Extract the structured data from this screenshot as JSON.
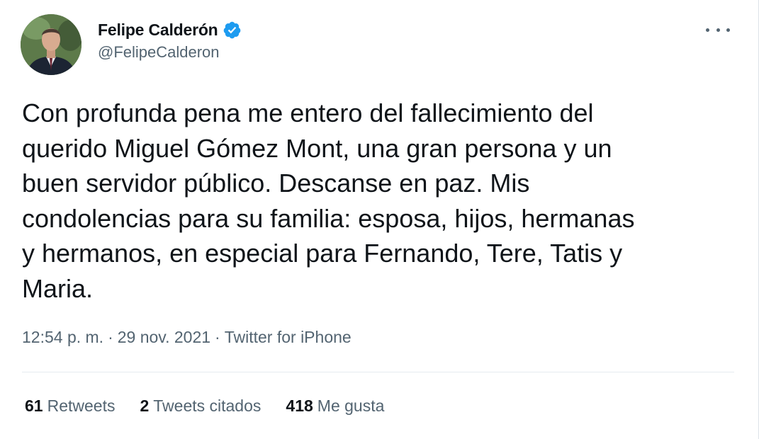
{
  "author": {
    "display_name": "Felipe Calderón",
    "handle": "@FelipeCalderon",
    "verified": true,
    "verified_icon": "verified-badge-icon"
  },
  "menu": {
    "icon": "more-options-icon"
  },
  "tweet": {
    "text": "Con profunda pena me entero del fallecimiento del\nquerido Miguel Gómez Mont, una gran persona y un\nbuen servidor público. Descanse en paz. Mis\ncondolencias para su familia: esposa, hijos, hermanas\ny hermanos, en especial para Fernando, Tere, Tatis y\nMaria."
  },
  "meta": {
    "time": "12:54 p. m.",
    "date": "29 nov. 2021",
    "source": "Twitter for iPhone",
    "separator": "·"
  },
  "stats": [
    {
      "count": "61",
      "label": "Retweets"
    },
    {
      "count": "2",
      "label": "Tweets citados"
    },
    {
      "count": "418",
      "label": "Me gusta"
    }
  ],
  "colors": {
    "verified_blue": "#1d9bf0",
    "secondary_text": "#536471",
    "primary_text": "#0f1419"
  }
}
